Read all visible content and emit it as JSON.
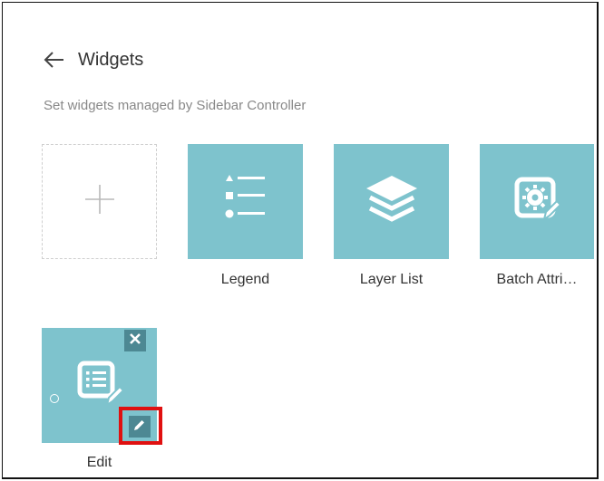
{
  "header": {
    "back_icon": "arrow-left-icon",
    "title": "Widgets"
  },
  "subtitle": "Set widgets managed by Sidebar Controller",
  "add_tile": {
    "icon": "plus-icon"
  },
  "widgets": [
    {
      "label": "Legend",
      "icon": "legend-list-icon"
    },
    {
      "label": "Layer List",
      "icon": "layers-stack-icon"
    },
    {
      "label": "Batch Attri…",
      "icon": "batch-attribute-gear-icon"
    },
    {
      "label": "Edit",
      "icon": "edit-document-icon"
    }
  ],
  "colors": {
    "tile": "#7ec3cd",
    "tile_button": "#4d8893",
    "highlight": "#e01010"
  }
}
